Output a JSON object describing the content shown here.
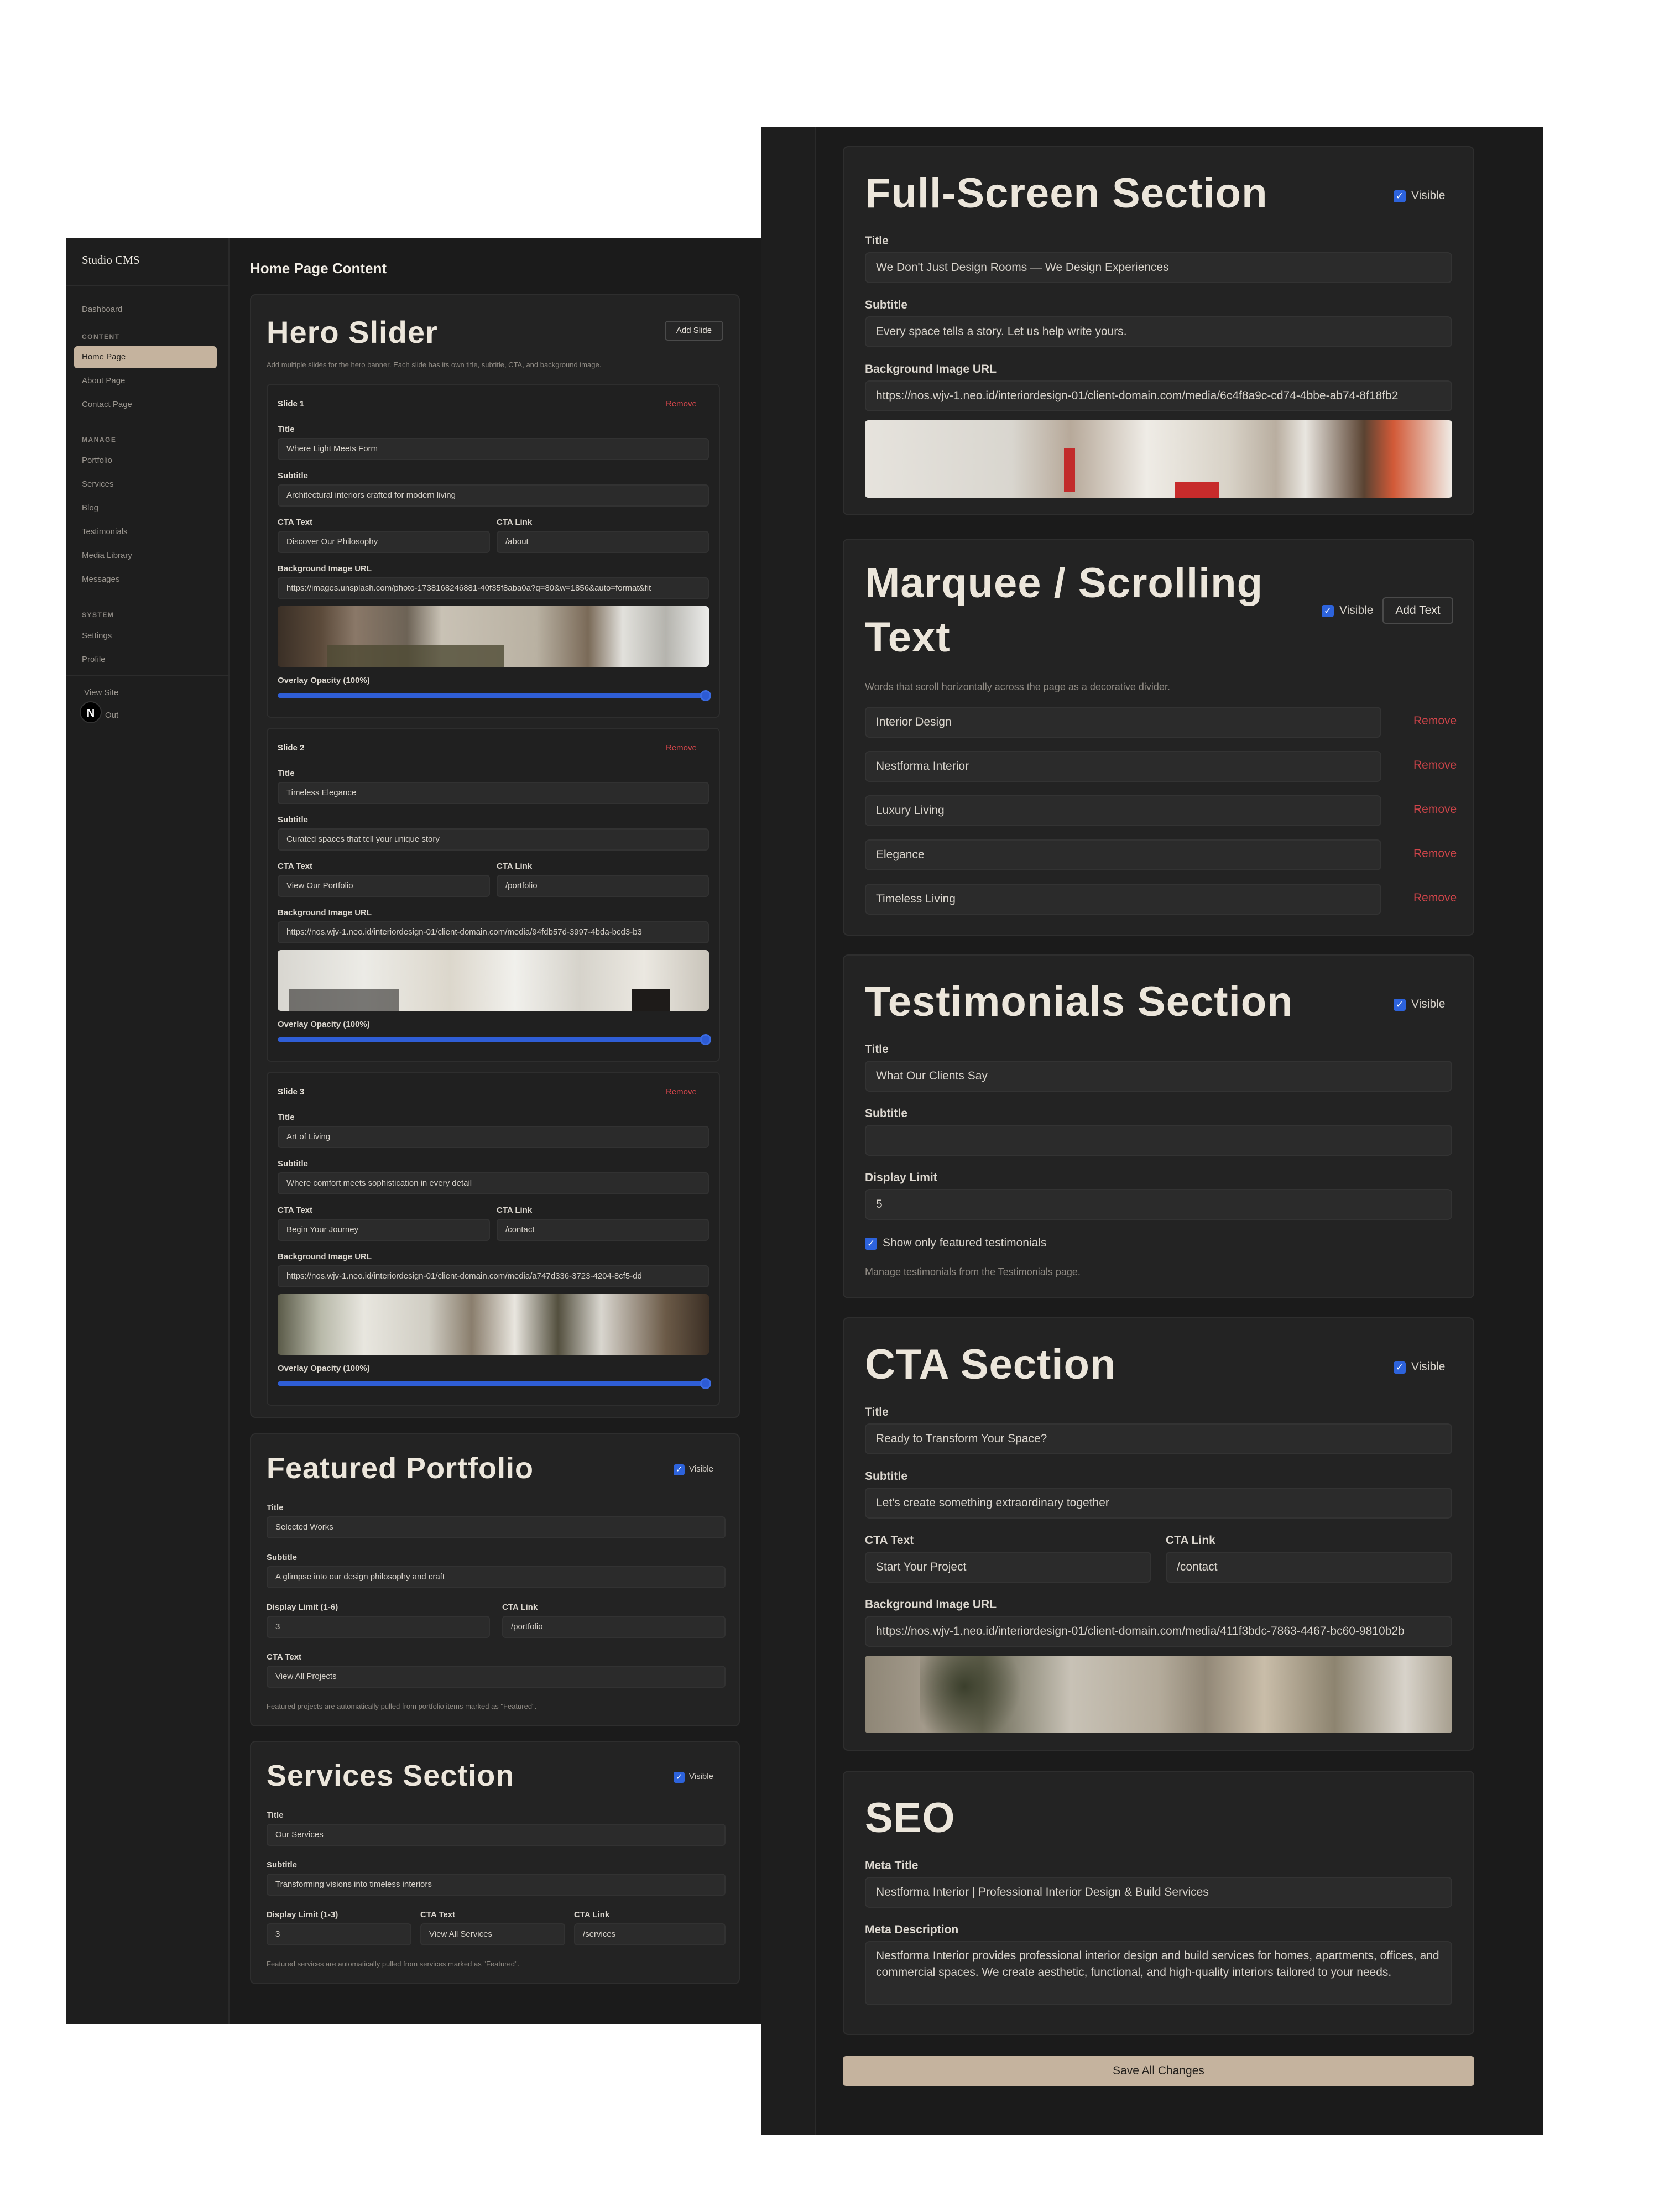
{
  "sidebar": {
    "brand": "Studio CMS",
    "dashboard": "Dashboard",
    "groups": {
      "content": "CONTENT",
      "manage": "MANAGE",
      "system": "SYSTEM"
    },
    "content_items": [
      "Home Page",
      "About Page",
      "Contact Page"
    ],
    "manage_items": [
      "Portfolio",
      "Services",
      "Blog",
      "Testimonials",
      "Media Library",
      "Messages"
    ],
    "system_items": [
      "Settings",
      "Profile"
    ],
    "view_site": "View Site",
    "sign_out": "Out",
    "avatar_letter": "N"
  },
  "page": {
    "title": "Home Page Content"
  },
  "hero": {
    "title": "Hero Slider",
    "add_slide": "Add Slide",
    "description": "Add multiple slides for the hero banner. Each slide has its own title, subtitle, CTA, and background image.",
    "labels": {
      "title": "Title",
      "subtitle": "Subtitle",
      "cta_text": "CTA Text",
      "cta_link": "CTA Link",
      "bg": "Background Image URL",
      "overlay": "Overlay Opacity (100%)",
      "remove": "Remove"
    },
    "overlay_value": 1.0,
    "slides": [
      {
        "name": "Slide 1",
        "title": "Where Light Meets Form",
        "subtitle": "Architectural interiors crafted for modern living",
        "cta_text": "Discover Our Philosophy",
        "cta_link": "/about",
        "bg": "https://images.unsplash.com/photo-1738168246881-40f35f8aba0a?q=80&w=1856&auto=format&fit"
      },
      {
        "name": "Slide 2",
        "title": "Timeless Elegance",
        "subtitle": "Curated spaces that tell your unique story",
        "cta_text": "View Our Portfolio",
        "cta_link": "/portfolio",
        "bg": "https://nos.wjv-1.neo.id/interiordesign-01/client-domain.com/media/94fdb57d-3997-4bda-bcd3-b3"
      },
      {
        "name": "Slide 3",
        "title": "Art of Living",
        "subtitle": "Where comfort meets sophistication in every detail",
        "cta_text": "Begin Your Journey",
        "cta_link": "/contact",
        "bg": "https://nos.wjv-1.neo.id/interiordesign-01/client-domain.com/media/a747d336-3723-4204-8cf5-dd"
      }
    ]
  },
  "featured": {
    "title": "Featured Portfolio",
    "visible": "Visible",
    "title_label": "Title",
    "title_value": "Selected Works",
    "subtitle_label": "Subtitle",
    "subtitle_value": "A glimpse into our design philosophy and craft",
    "limit_label": "Display Limit (1-6)",
    "limit_value": "3",
    "link_label": "CTA Link",
    "link_value": "/portfolio",
    "cta_label": "CTA Text",
    "cta_value": "View All Projects",
    "note": "Featured projects are automatically pulled from portfolio items marked as \"Featured\"."
  },
  "services": {
    "title": "Services Section",
    "visible": "Visible",
    "title_label": "Title",
    "title_value": "Our Services",
    "subtitle_label": "Subtitle",
    "subtitle_value": "Transforming visions into timeless interiors",
    "limit_label": "Display Limit (1-3)",
    "limit_value": "3",
    "cta_label": "CTA Text",
    "cta_value": "View All Services",
    "link_label": "CTA Link",
    "link_value": "/services",
    "note": "Featured services are automatically pulled from services marked as \"Featured\"."
  },
  "fullscreen": {
    "title": "Full-Screen Section",
    "visible": "Visible",
    "title_label": "Title",
    "title_value": "We Don't Just Design Rooms — We Design Experiences",
    "subtitle_label": "Subtitle",
    "subtitle_value": "Every space tells a story. Let us help write yours.",
    "bg_label": "Background Image URL",
    "bg_value": "https://nos.wjv-1.neo.id/interiordesign-01/client-domain.com/media/6c4f8a9c-cd74-4bbe-ab74-8f18fb2"
  },
  "marquee": {
    "title_line1": "Marquee / Scrolling",
    "title_line2": "Text",
    "visible": "Visible",
    "add_text": "Add Text",
    "description": "Words that scroll horizontally across the page as a decorative divider.",
    "remove": "Remove",
    "items": [
      "Interior Design",
      "Nestforma Interior",
      "Luxury Living",
      "Elegance",
      "Timeless Living"
    ]
  },
  "testimonials": {
    "title": "Testimonials Section",
    "visible": "Visible",
    "title_label": "Title",
    "title_value": "What Our Clients Say",
    "subtitle_label": "Subtitle",
    "subtitle_value": "",
    "limit_label": "Display Limit",
    "limit_value": "5",
    "featured_only": "Show only featured testimonials",
    "note": "Manage testimonials from the Testimonials page."
  },
  "cta": {
    "title": "CTA Section",
    "visible": "Visible",
    "title_label": "Title",
    "title_value": "Ready to Transform Your Space?",
    "subtitle_label": "Subtitle",
    "subtitle_value": "Let's create something extraordinary together",
    "cta_label": "CTA Text",
    "cta_value": "Start Your Project",
    "link_label": "CTA Link",
    "link_value": "/contact",
    "bg_label": "Background Image URL",
    "bg_value": "https://nos.wjv-1.neo.id/interiordesign-01/client-domain.com/media/411f3bdc-7863-4467-bc60-9810b2b"
  },
  "seo": {
    "title": "SEO",
    "meta_title_label": "Meta Title",
    "meta_title_value": "Nestforma Interior | Professional Interior Design & Build Services",
    "meta_desc_label": "Meta Description",
    "meta_desc_value": "Nestforma Interior provides professional interior design and build services for homes, apartments, offices, and commercial spaces. We create aesthetic, functional, and high-quality interiors tailored to your needs."
  },
  "save_button": "Save All Changes",
  "colors": {
    "accent": "#c5b39e",
    "danger": "#d0454a",
    "checkbox": "#2d63dc",
    "slider": "#2f5ed6"
  }
}
